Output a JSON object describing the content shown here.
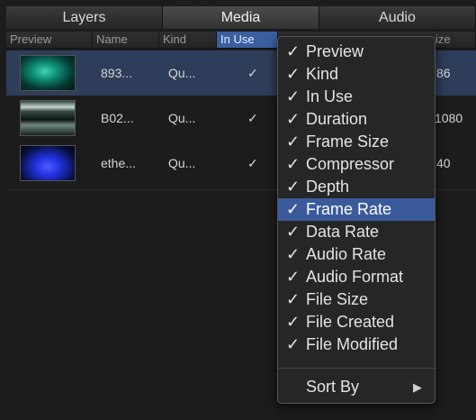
{
  "tabs": [
    {
      "label": "Layers"
    },
    {
      "label": "Media"
    },
    {
      "label": "Audio"
    }
  ],
  "columns": {
    "preview": "Preview",
    "name": "Name",
    "kind": "Kind",
    "in_use": "In Use",
    "size_partial": "ize"
  },
  "rows": [
    {
      "name": "893...",
      "kind": "Qu...",
      "in_use": "✓",
      "extra": "86"
    },
    {
      "name": "B02...",
      "kind": "Qu...",
      "in_use": "✓",
      "extra": "1080"
    },
    {
      "name": "ethe...",
      "kind": "Qu...",
      "in_use": "✓",
      "extra": "40"
    }
  ],
  "menu": {
    "check": "✓",
    "items": [
      "Preview",
      "Kind",
      "In Use",
      "Duration",
      "Frame Size",
      "Compressor",
      "Depth",
      "Frame Rate",
      "Data Rate",
      "Audio Rate",
      "Audio Format",
      "File Size",
      "File Created",
      "File Modified"
    ],
    "highlighted": "Frame Rate",
    "sort_by": "Sort By",
    "submenu_arrow": "▶"
  },
  "colors": {
    "background": "#1c1c1c",
    "selection": "#3b5a9c",
    "selected_row": "#2e3d59"
  }
}
